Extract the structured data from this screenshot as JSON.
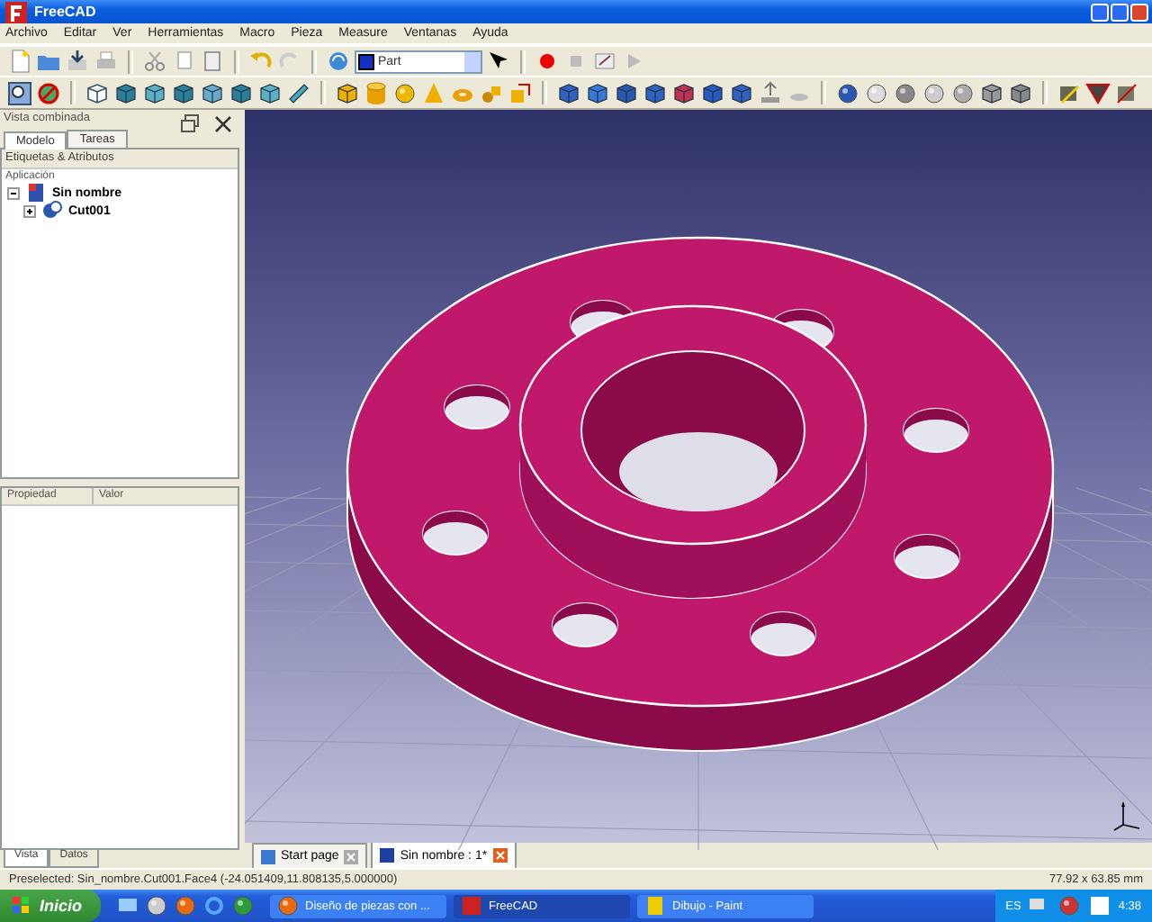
{
  "window": {
    "title": "FreeCAD"
  },
  "menu": [
    "Archivo",
    "Editar",
    "Ver",
    "Herramientas",
    "Macro",
    "Pieza",
    "Measure",
    "Ventanas",
    "Ayuda"
  ],
  "toolbar": {
    "workbench": "Part"
  },
  "combo_view": {
    "title": "Vista combinada",
    "tabs": [
      {
        "label": "Modelo",
        "selected": true
      },
      {
        "label": "Tareas",
        "selected": false
      }
    ],
    "tree_header": "Etiquetas & Atributos",
    "tree_group": "Aplicación",
    "tree": [
      {
        "label": "Sin nombre",
        "expanded": true,
        "children": [
          {
            "label": "Cut001",
            "expanded": false
          }
        ]
      }
    ],
    "property_columns": [
      "Propiedad",
      "Valor"
    ],
    "bottom_tabs": [
      {
        "label": "Vista",
        "selected": true
      },
      {
        "label": "Datos",
        "selected": false
      }
    ]
  },
  "document_tabs": [
    {
      "label": "Start page",
      "selected": false
    },
    {
      "label": "Sin nombre : 1*",
      "selected": true
    }
  ],
  "status_bar": {
    "message": "Preselected: Sin_nombre.Cut001.Face4 (-24.051409,11.808135,5.000000)",
    "dimensions": "77.92 x 63.85 mm"
  },
  "taskbar": {
    "start": "Inicio",
    "windows": [
      {
        "label": "Diseño de piezas con ...",
        "selected": false
      },
      {
        "label": "FreeCAD",
        "selected": true
      },
      {
        "label": "Dibujo - Paint",
        "selected": false
      }
    ],
    "language": "ES",
    "clock": "4:38"
  }
}
